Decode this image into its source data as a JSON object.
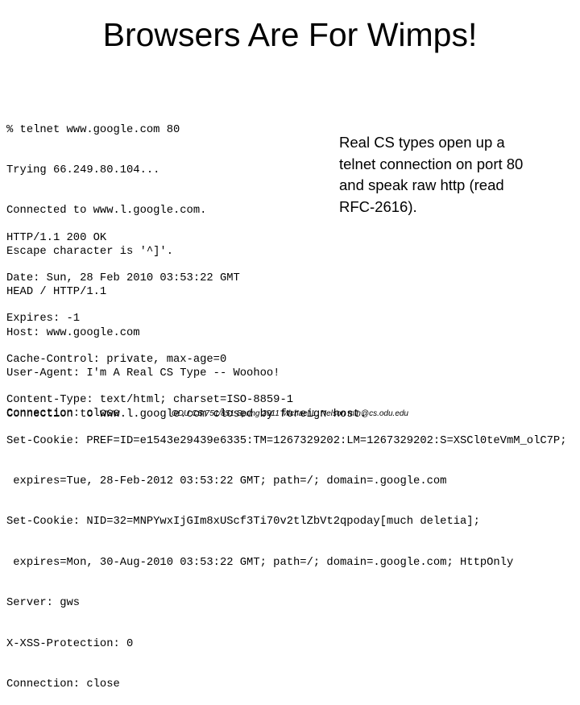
{
  "slide": {
    "title": "Browsers Are For Wimps!",
    "request_lines": [
      "% telnet www.google.com 80",
      "Trying 66.249.80.104...",
      "Connected to www.l.google.com.",
      "Escape character is '^]'.",
      "HEAD / HTTP/1.1",
      "Host: www.google.com",
      "User-Agent: I'm A Real CS Type -- Woohoo!",
      "Connection: close"
    ],
    "response_lines": [
      "HTTP/1.1 200 OK",
      "Date: Sun, 28 Feb 2010 03:53:22 GMT",
      "Expires: -1",
      "Cache-Control: private, max-age=0",
      "Content-Type: text/html; charset=ISO-8859-1",
      "Set-Cookie: PREF=ID=e1543e29439e6335:TM=1267329202:LM=1267329202:S=XSCl0teVmM_olC7P;",
      " expires=Tue, 28-Feb-2012 03:53:22 GMT; path=/; domain=.google.com",
      "Set-Cookie: NID=32=MNPYwxIjGIm8xUScf3Ti70v2tlZbVt2qpoday[much deletia];",
      " expires=Mon, 30-Aug-2010 03:53:22 GMT; path=/; domain=.google.com; HttpOnly",
      "Server: gws",
      "X-XSS-Protection: 0",
      "Connection: close"
    ],
    "closing_line": "Connection to www.l.google.com closed by foreign host.",
    "callout_lines": [
      "Real CS types open up a",
      "telnet connection on port 80",
      "and speak raw http (read",
      "RFC-2616)."
    ],
    "footer": "ODU CS 751/851  Spring 2011 Michael L. Nelson mln@cs.odu.edu"
  }
}
